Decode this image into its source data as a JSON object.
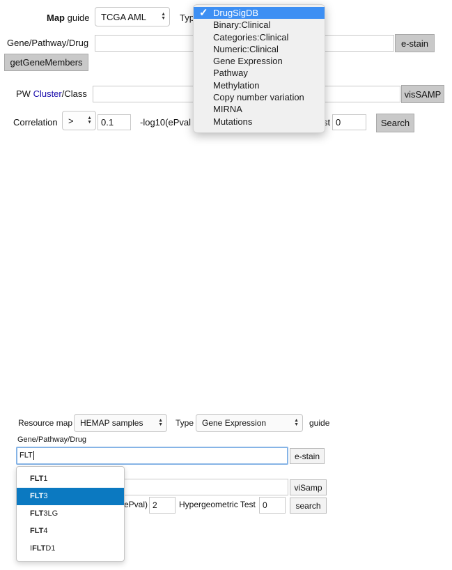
{
  "top_form": {
    "map_guide": {
      "label_bold": "Map",
      "label_rest": " guide",
      "value": "TCGA AML"
    },
    "type": {
      "label": "Typ"
    },
    "type_menu": {
      "items": [
        {
          "label": "DrugSigDB",
          "selected": true
        },
        {
          "label": "Binary:Clinical",
          "selected": false
        },
        {
          "label": "Categories:Clinical",
          "selected": false
        },
        {
          "label": "Numeric:Clinical",
          "selected": false
        },
        {
          "label": "Gene Expression",
          "selected": false
        },
        {
          "label": "Pathway",
          "selected": false
        },
        {
          "label": "Methylation",
          "selected": false
        },
        {
          "label": "Copy number variation",
          "selected": false
        },
        {
          "label": "MIRNA",
          "selected": false
        },
        {
          "label": "Mutations",
          "selected": false
        }
      ]
    },
    "gene_pathway_drug": {
      "label": "Gene/Pathway/Drug",
      "value": ""
    },
    "estain_button": "e-stain",
    "get_gene_members_button": "getGeneMembers",
    "pw_cluster_class": {
      "pw": "PW ",
      "cluster_link": "Cluster",
      "class": "/Class",
      "value": ""
    },
    "vissamp_button": "visSAMP",
    "correlation": {
      "label": "Correlation",
      "operator": ">",
      "value": "0.1"
    },
    "log10_label": "-log10(ePval",
    "test_label": "st",
    "test_value": "0",
    "search_button": "Search"
  },
  "bottom_form": {
    "resource_map": {
      "label": "Resource map",
      "value": "HEMAP samples"
    },
    "type": {
      "label": "Type",
      "value": "Gene Expression"
    },
    "guide_label": "guide",
    "gene_pathway_drug": {
      "label": "Gene/Pathway/Drug",
      "value": "FLT"
    },
    "estain_button": "e-stain",
    "visamp_button": "viSamp",
    "pval_label": "ePval)",
    "pval_value": "2",
    "hypergeometric": {
      "label": "Hypergeometric Test",
      "value": "0"
    },
    "search_button": "search",
    "autocomplete": [
      {
        "bold": "FLT",
        "rest": "1",
        "active": false
      },
      {
        "bold": "FLT",
        "rest": "3",
        "active": true
      },
      {
        "bold": "FLT",
        "rest": "3LG",
        "active": false
      },
      {
        "bold": "FLT",
        "rest": "4",
        "active": false
      },
      {
        "prefix": "I",
        "bold": "FLT",
        "rest": "D1",
        "active": false
      }
    ]
  },
  "colors": {
    "menu_highlight": "#3d8ff3",
    "autocomplete_highlight": "#0b79c1",
    "cluster_link": "#1a0dab",
    "focus_ring": "#86b4e6"
  }
}
